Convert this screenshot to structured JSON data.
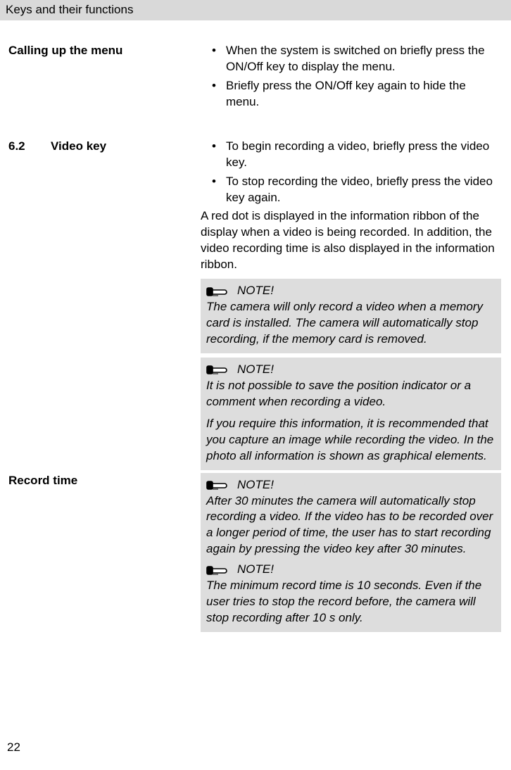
{
  "header": {
    "title": "Keys and their functions"
  },
  "section_calling": {
    "heading": "Calling up the menu",
    "items": [
      "When the system is switched on briefly press the ON/Off key to display the menu.",
      "Briefly press the ON/Off key again to hide the menu."
    ]
  },
  "section_video": {
    "number": "6.2",
    "heading": "Video key",
    "items": [
      "To begin recording a video, briefly press the video key.",
      "To stop recording the video, briefly press the video key again."
    ],
    "paragraph": "A red dot is displayed in the information ribbon of the display when a video is being recorded. In addition, the video recording time is also displayed in the information ribbon.",
    "note1": {
      "label": "NOTE!",
      "body": "The camera will only record a video when a memory card is installed. The camera will auto­matically stop recording, if the memory card is re­moved."
    },
    "note2": {
      "label": "NOTE!",
      "body1": "It is not possible to save the position indicator or a comment when recording a video.",
      "body2": "If you require this information, it is recommended that you capture an image while recording the vid­eo. In the photo all information is shown as graph­ical elements."
    }
  },
  "section_record": {
    "heading": "Record time",
    "note3": {
      "label": "NOTE!",
      "body": "After 30 minutes the camera will automatically stop recording a video. If the video has to be recorded over a longer period of time, the user has to start recording again by pressing the video key after 30 minutes."
    },
    "note4": {
      "label": "NOTE!",
      "body": "The minimum record time is 10 seconds. Even if the user tries to stop the record before, the camera will stop recording after 10 s only."
    }
  },
  "page_number": "22",
  "bullet_char": "•"
}
